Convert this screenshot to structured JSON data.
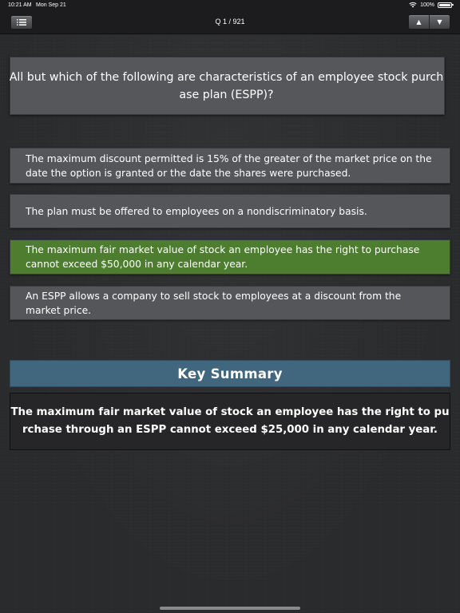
{
  "status_bar": {
    "time": "10:21 AM",
    "date": "Mon Sep 21",
    "battery_text": "100%",
    "battery_level": 1.0
  },
  "nav": {
    "title": "Q 1 / 921",
    "menu_icon": "list-icon",
    "up_arrow": "▲",
    "down_arrow": "▼"
  },
  "question": {
    "text": "All but which of the following are characteristics of an employee stock purchase plan (ESPP)?"
  },
  "answers": [
    {
      "text": "The maximum discount permitted is 15% of the greater of the market price on the date the option is granted or the date the shares were purchased.",
      "state": "default"
    },
    {
      "text": "The plan must be offered to employees on a nondiscriminatory basis.",
      "state": "default"
    },
    {
      "text": "The maximum fair market value of stock an employee has the right to purchase cannot exceed $50,000 in any calendar year.",
      "state": "correct"
    },
    {
      "text": "An ESPP allows a company to sell stock to employees at a discount from the market price.",
      "state": "default"
    }
  ],
  "summary": {
    "header": "Key Summary",
    "text": "The maximum fair market value of stock an employee has the right to purchase through an ESPP cannot exceed $25,000 in any calendar year."
  },
  "colors": {
    "background": "#2a2b2d",
    "answer_default": "#55565a",
    "answer_correct": "#4d7d2e",
    "summary_header": "#41677f",
    "summary_box": "#262628"
  }
}
